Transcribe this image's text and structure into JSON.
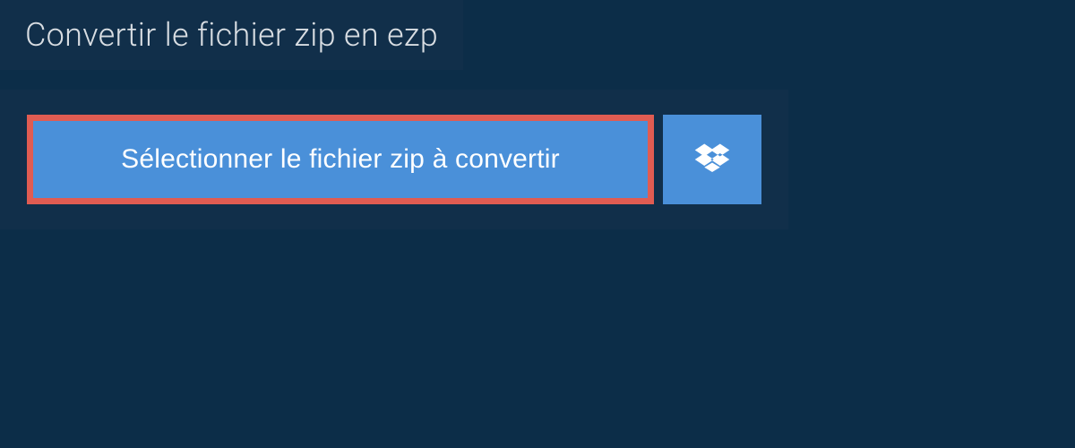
{
  "header": {
    "title": "Convertir le fichier zip en ezp"
  },
  "actions": {
    "select_file_label": "Sélectionner le fichier zip à convertir"
  },
  "colors": {
    "page_bg": "#0c2d48",
    "panel_bg": "#112f4a",
    "button_bg": "#4a90d9",
    "highlight_border": "#e05c52",
    "title_text": "#d8dde2",
    "button_text": "#ffffff"
  }
}
